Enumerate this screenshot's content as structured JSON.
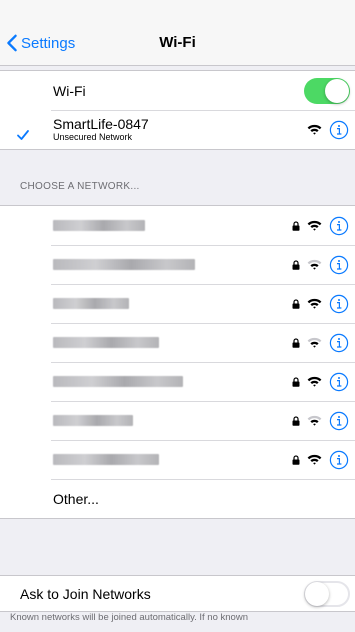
{
  "navbar": {
    "back_label": "Settings",
    "title": "Wi-Fi"
  },
  "wifi_toggle": {
    "label": "Wi-Fi",
    "on": true
  },
  "connected": {
    "name": "SmartLife-0847",
    "subtitle": "Unsecured Network"
  },
  "networks_header": "CHOOSE A NETWORK...",
  "networks": [
    {
      "name": "",
      "secured": true,
      "signal": 3
    },
    {
      "name": "",
      "secured": true,
      "signal": 2
    },
    {
      "name": "",
      "secured": true,
      "signal": 3
    },
    {
      "name": "",
      "secured": true,
      "signal": 2
    },
    {
      "name": "",
      "secured": true,
      "signal": 3
    },
    {
      "name": "",
      "secured": true,
      "signal": 2
    },
    {
      "name": "",
      "secured": true,
      "signal": 3
    }
  ],
  "other_label": "Other...",
  "ask_to_join": {
    "label": "Ask to Join Networks",
    "on": false
  },
  "footer": "Known networks will be joined automatically. If no known",
  "colors": {
    "accent": "#0a7aff",
    "toggle_on": "#4cd964"
  },
  "icons": [
    "chevron-left-icon",
    "checkmark-icon",
    "lock-icon",
    "wifi-icon",
    "info-icon"
  ]
}
